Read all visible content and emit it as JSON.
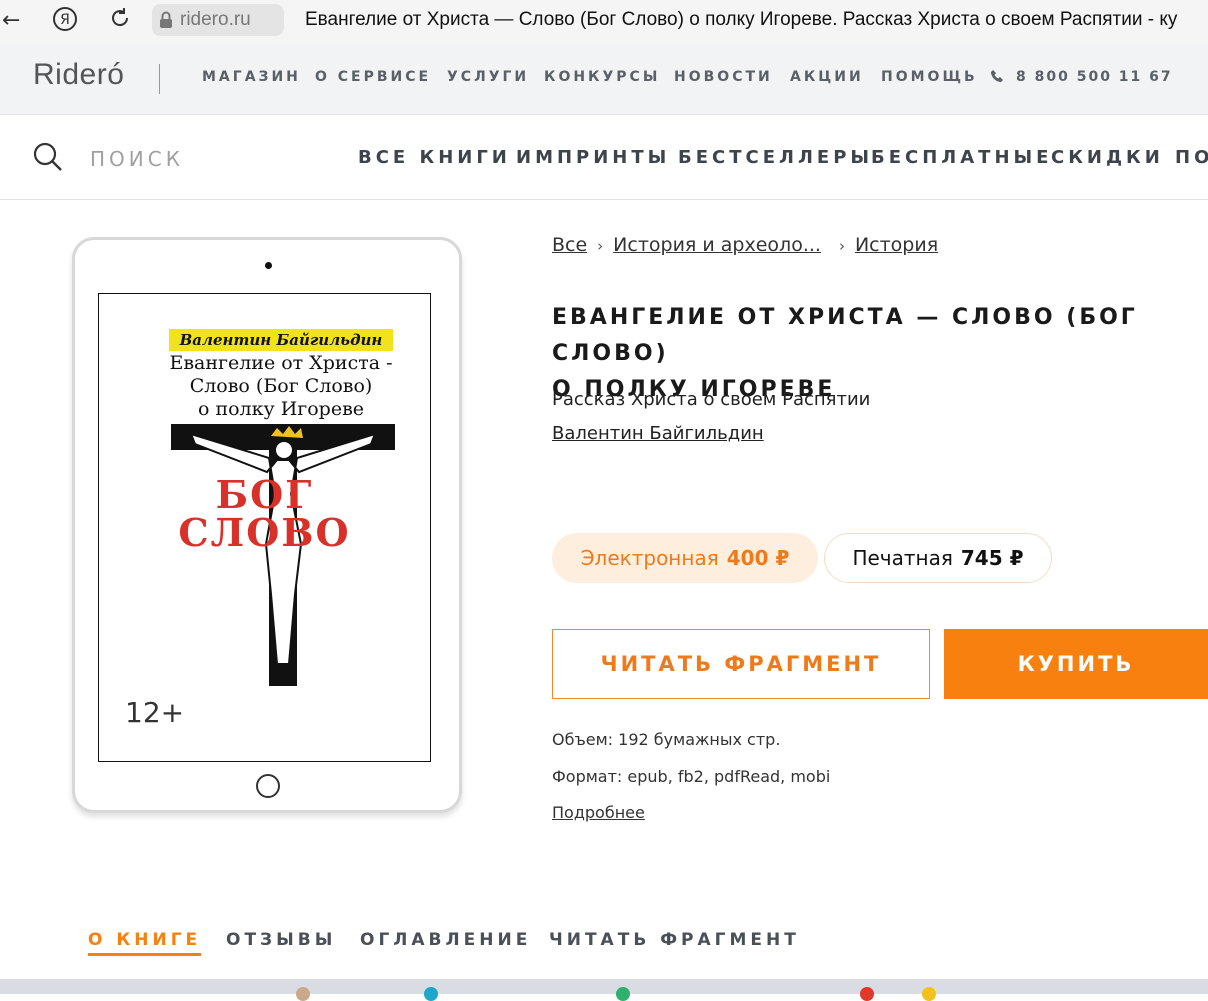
{
  "browser": {
    "url": "ridero.ru",
    "tab_title": "Евангелие от Христа — Слово (Бог Слово) о полку Игореве. Рассказ Христа о своем Распятии - ку"
  },
  "header": {
    "logo": "Rideró",
    "menu": [
      "МАГАЗИН",
      "О СЕРВИСЕ",
      "УСЛУГИ",
      "КОНКУРСЫ",
      "НОВОСТИ",
      "АКЦИИ",
      "ПОМОЩЬ"
    ],
    "phone": "8 800 500 11 67"
  },
  "catnav": {
    "search_placeholder": "ПОИСК",
    "items": [
      "ВСЕ КНИГИ",
      "ИМПРИНТЫ",
      "БЕСТСЕЛЛЕРЫ",
      "БЕСПЛАТНЫЕ",
      "СКИДКИ",
      "ПО"
    ]
  },
  "cover": {
    "author": "Валентин Байгильдин",
    "title_lines": [
      "Евангелие от Христа -",
      "Слово (Бог Слово)",
      "о полку Игореве"
    ],
    "word1": "БОГ",
    "word2": "СЛОВО",
    "age": "12+"
  },
  "breadcrumb": [
    "Все",
    "История и археоло...",
    "История"
  ],
  "book": {
    "title_line1": "ЕВАНГЕЛИЕ ОТ ХРИСТА — СЛОВО (БОГ СЛОВО)",
    "title_line2": "О ПОЛКУ ИГОРЕВЕ",
    "subtitle": "Рассказ Христа о своем Распятии",
    "author": "Валентин Байгильдин"
  },
  "formats": {
    "ebook_label": "Электронная",
    "ebook_price": "400 ₽",
    "print_label": "Печатная",
    "print_price": "745 ₽"
  },
  "actions": {
    "read_fragment": "ЧИТАТЬ ФРАГМЕНТ",
    "buy": "КУПИТЬ"
  },
  "details": {
    "volume": "Объем: 192 бумажных стр.",
    "format": "Формат: epub, fb2, pdfRead, mobi",
    "more": "Подробнее"
  },
  "tabs": [
    "О КНИГЕ",
    "ОТЗЫВЫ",
    "ОГЛАВЛЕНИЕ",
    "ЧИТАТЬ ФРАГМЕНТ"
  ],
  "colors": {
    "accent": "#f7800f",
    "ebook_bg": "#fdeede",
    "cover_red": "#d8312a",
    "cover_yellow": "#f2e21c"
  }
}
